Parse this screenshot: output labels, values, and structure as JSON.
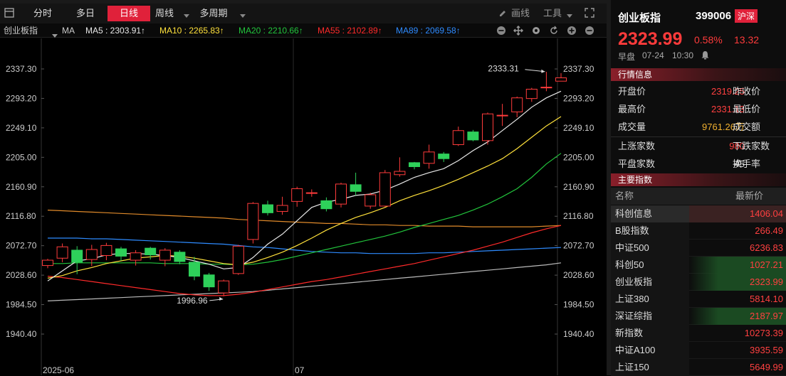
{
  "toolbar": {
    "tabs": [
      "分时",
      "多日",
      "日线",
      "周线",
      "多周期"
    ],
    "active_tab": "日线",
    "draw_label": "画线",
    "tools_label": "工具"
  },
  "ma_bar": {
    "name": "创业板指",
    "ma_label": "MA",
    "ma5": "MA5 : 2303.91↑",
    "ma10": "MA10 : 2265.83↑",
    "ma20": "MA20 : 2210.66↑",
    "ma55": "MA55 : 2102.89↑",
    "ma89": "MA89 : 2069.58↑"
  },
  "colors": {
    "up": "#ff3b3b",
    "down": "#2ed05a",
    "ma5": "#e8e8e8",
    "ma10": "#ffe13b",
    "ma20": "#22c43c",
    "ma55": "#ff2a2a",
    "ma89": "#2e8bff"
  },
  "chart_data": {
    "type": "candlestick",
    "y_ticks": [
      "2337.30",
      "2293.20",
      "2249.10",
      "2205.00",
      "2160.90",
      "2116.80",
      "2072.70",
      "2028.60",
      "1984.50",
      "1940.40"
    ],
    "ylim": [
      1940.4,
      2337.3
    ],
    "x_labels": [
      "2025-06",
      "07"
    ],
    "high_label": "2333.31",
    "low_label": "1996.96",
    "candles": [
      [
        2043,
        2051,
        2039,
        2053
      ],
      [
        2054,
        2071,
        2048,
        2076
      ],
      [
        2066,
        2048,
        2030,
        2072
      ],
      [
        2052,
        2067,
        2042,
        2074
      ],
      [
        2058,
        2073,
        2051,
        2077
      ],
      [
        2068,
        2057,
        2050,
        2071
      ],
      [
        2051,
        2062,
        2043,
        2066
      ],
      [
        2069,
        2059,
        2052,
        2071
      ],
      [
        2051,
        2066,
        2042,
        2069
      ],
      [
        2063,
        2049,
        2045,
        2066
      ],
      [
        2048,
        2027,
        2021,
        2056
      ],
      [
        2029,
        2011,
        2005,
        2032
      ],
      [
        2002,
        2020,
        1997,
        2022
      ],
      [
        2031,
        2072,
        2029,
        2074
      ],
      [
        2082,
        2136,
        2076,
        2138
      ],
      [
        2134,
        2122,
        2118,
        2140
      ],
      [
        2124,
        2133,
        2119,
        2146
      ],
      [
        2139,
        2158,
        2131,
        2161
      ],
      [
        2152,
        2152,
        2146,
        2157
      ],
      [
        2140,
        2128,
        2124,
        2145
      ],
      [
        2135,
        2165,
        2130,
        2167
      ],
      [
        2164,
        2154,
        2148,
        2182
      ],
      [
        2132,
        2149,
        2128,
        2152
      ],
      [
        2132,
        2182,
        2131,
        2186
      ],
      [
        2179,
        2184,
        2176,
        2205
      ],
      [
        2197,
        2191,
        2187,
        2198
      ],
      [
        2196,
        2213,
        2188,
        2224
      ],
      [
        2210,
        2203,
        2198,
        2213
      ],
      [
        2224,
        2245,
        2222,
        2251
      ],
      [
        2243,
        2231,
        2229,
        2246
      ],
      [
        2230,
        2270,
        2224,
        2272
      ],
      [
        2268,
        2268,
        2252,
        2285
      ],
      [
        2273,
        2294,
        2265,
        2296
      ],
      [
        2293,
        2307,
        2288,
        2309
      ],
      [
        2310,
        2310,
        2304,
        2333
      ],
      [
        2319,
        2324,
        2319,
        2331
      ]
    ],
    "ma5": [
      2020,
      2035,
      2050,
      2053,
      2059,
      2061,
      2061,
      2060,
      2058,
      2055,
      2050,
      2045,
      2038,
      2040,
      2055,
      2075,
      2090,
      2110,
      2130,
      2138,
      2142,
      2148,
      2150,
      2156,
      2165,
      2175,
      2182,
      2188,
      2200,
      2215,
      2228,
      2245,
      2262,
      2280,
      2294,
      2304
    ],
    "ma10": [
      2024,
      2028,
      2035,
      2040,
      2046,
      2050,
      2054,
      2056,
      2058,
      2057,
      2054,
      2050,
      2046,
      2044,
      2048,
      2055,
      2063,
      2073,
      2084,
      2096,
      2106,
      2115,
      2122,
      2130,
      2140,
      2148,
      2155,
      2163,
      2172,
      2182,
      2192,
      2203,
      2218,
      2235,
      2252,
      2266
    ],
    "ma20": [
      2046,
      2046,
      2047,
      2047,
      2047,
      2047,
      2047,
      2047,
      2046,
      2046,
      2046,
      2045,
      2045,
      2044,
      2045,
      2048,
      2052,
      2057,
      2062,
      2067,
      2072,
      2077,
      2082,
      2087,
      2093,
      2100,
      2106,
      2112,
      2118,
      2126,
      2135,
      2146,
      2158,
      2175,
      2195,
      2211
    ],
    "ma55": [
      2027,
      2025,
      2022,
      2019,
      2016,
      2013,
      2010,
      2007,
      2004,
      2001,
      1999,
      1998,
      1998,
      2000,
      2003,
      2007,
      2011,
      2015,
      2019,
      2022,
      2026,
      2030,
      2034,
      2038,
      2042,
      2046,
      2051,
      2056,
      2061,
      2066,
      2072,
      2078,
      2085,
      2092,
      2098,
      2103
    ],
    "ma89": [
      2084,
      2084,
      2084,
      2083,
      2083,
      2082,
      2081,
      2080,
      2079,
      2078,
      2077,
      2076,
      2075,
      2073,
      2071,
      2070,
      2068,
      2066,
      2064,
      2063,
      2062,
      2062,
      2061,
      2061,
      2061,
      2061,
      2062,
      2062,
      2063,
      2064,
      2065,
      2066,
      2067,
      2068,
      2069,
      2070
    ],
    "ma_orange": [
      2126,
      2125,
      2124,
      2123,
      2122,
      2121,
      2120,
      2119,
      2118,
      2117,
      2116,
      2115,
      2114,
      2112,
      2111,
      2110,
      2109,
      2108,
      2107,
      2106,
      2106,
      2105,
      2104,
      2104,
      2103,
      2103,
      2102,
      2102,
      2102,
      2101,
      2101,
      2101,
      2101,
      2101,
      2102,
      2103
    ],
    "ma_gray": [
      1990,
      1991,
      1992,
      1993,
      1994,
      1995,
      1996,
      1997,
      1998,
      1999,
      2000,
      2001,
      2002,
      2003,
      2004,
      2006,
      2008,
      2010,
      2012,
      2014,
      2016,
      2018,
      2020,
      2022,
      2024,
      2026,
      2028,
      2030,
      2032,
      2034,
      2036,
      2038,
      2040,
      2042,
      2044,
      2047
    ]
  },
  "quote": {
    "name": "创业板指",
    "code": "399006",
    "market": "沪深",
    "price": "2323.99",
    "pct": "0.58%",
    "change": "13.32",
    "session": "早盘",
    "date": "07-24",
    "time": "10:30",
    "section_title": "行情信息",
    "rows": [
      {
        "label": "开盘价",
        "value": "2319.25",
        "label2": "昨收价"
      },
      {
        "label": "最高价",
        "value": "2331.13",
        "label2": "最低价"
      },
      {
        "label": "成交量",
        "value": "9761.26万",
        "label2": "成交额"
      },
      {
        "label": "上涨家数",
        "value": "980",
        "label2": "下跌家数"
      },
      {
        "label": "平盘家数",
        "value": "45",
        "label2": "换手率"
      }
    ]
  },
  "indices": {
    "section_title": "主要指数",
    "col_name": "名称",
    "col_price": "最新价",
    "items": [
      {
        "name": "科创信息",
        "price": "1406.04"
      },
      {
        "name": "B股指数",
        "price": "266.49"
      },
      {
        "name": "中证500",
        "price": "6236.83"
      },
      {
        "name": "科创50",
        "price": "1027.21"
      },
      {
        "name": "创业板指",
        "price": "2323.99"
      },
      {
        "name": "上证380",
        "price": "5814.10"
      },
      {
        "name": "深证综指",
        "price": "2187.97"
      },
      {
        "name": "新指数",
        "price": "10273.39"
      },
      {
        "name": "中证A100",
        "price": "3935.59"
      },
      {
        "name": "上证150",
        "price": "5649.99"
      }
    ]
  }
}
